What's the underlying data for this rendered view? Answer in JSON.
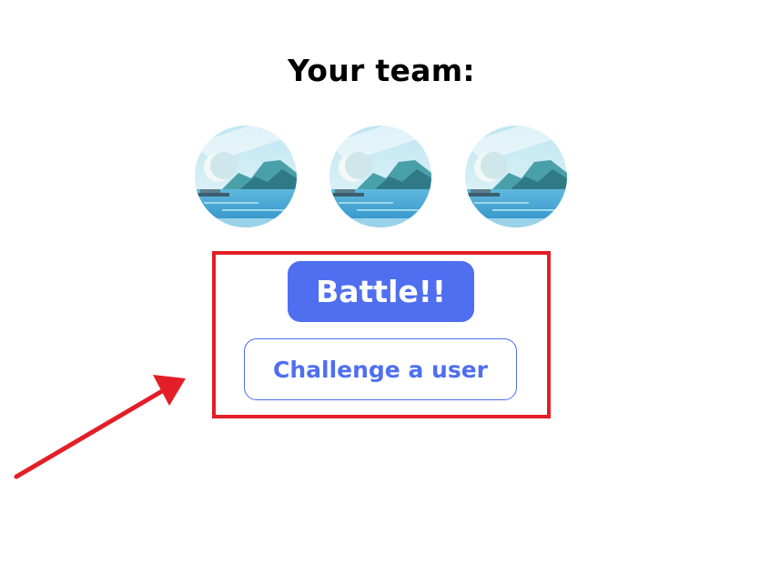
{
  "team": {
    "title": "Your team:",
    "members": [
      {
        "icon": "landscape-lake-icon"
      },
      {
        "icon": "landscape-lake-icon"
      },
      {
        "icon": "landscape-lake-icon"
      }
    ]
  },
  "actions": {
    "battle_label": "Battle!!",
    "challenge_label": "Challenge a user"
  },
  "annotation": {
    "highlight_color": "#e41e26",
    "arrow_color": "#e41e26"
  },
  "colors": {
    "primary": "#4f6ff0"
  }
}
